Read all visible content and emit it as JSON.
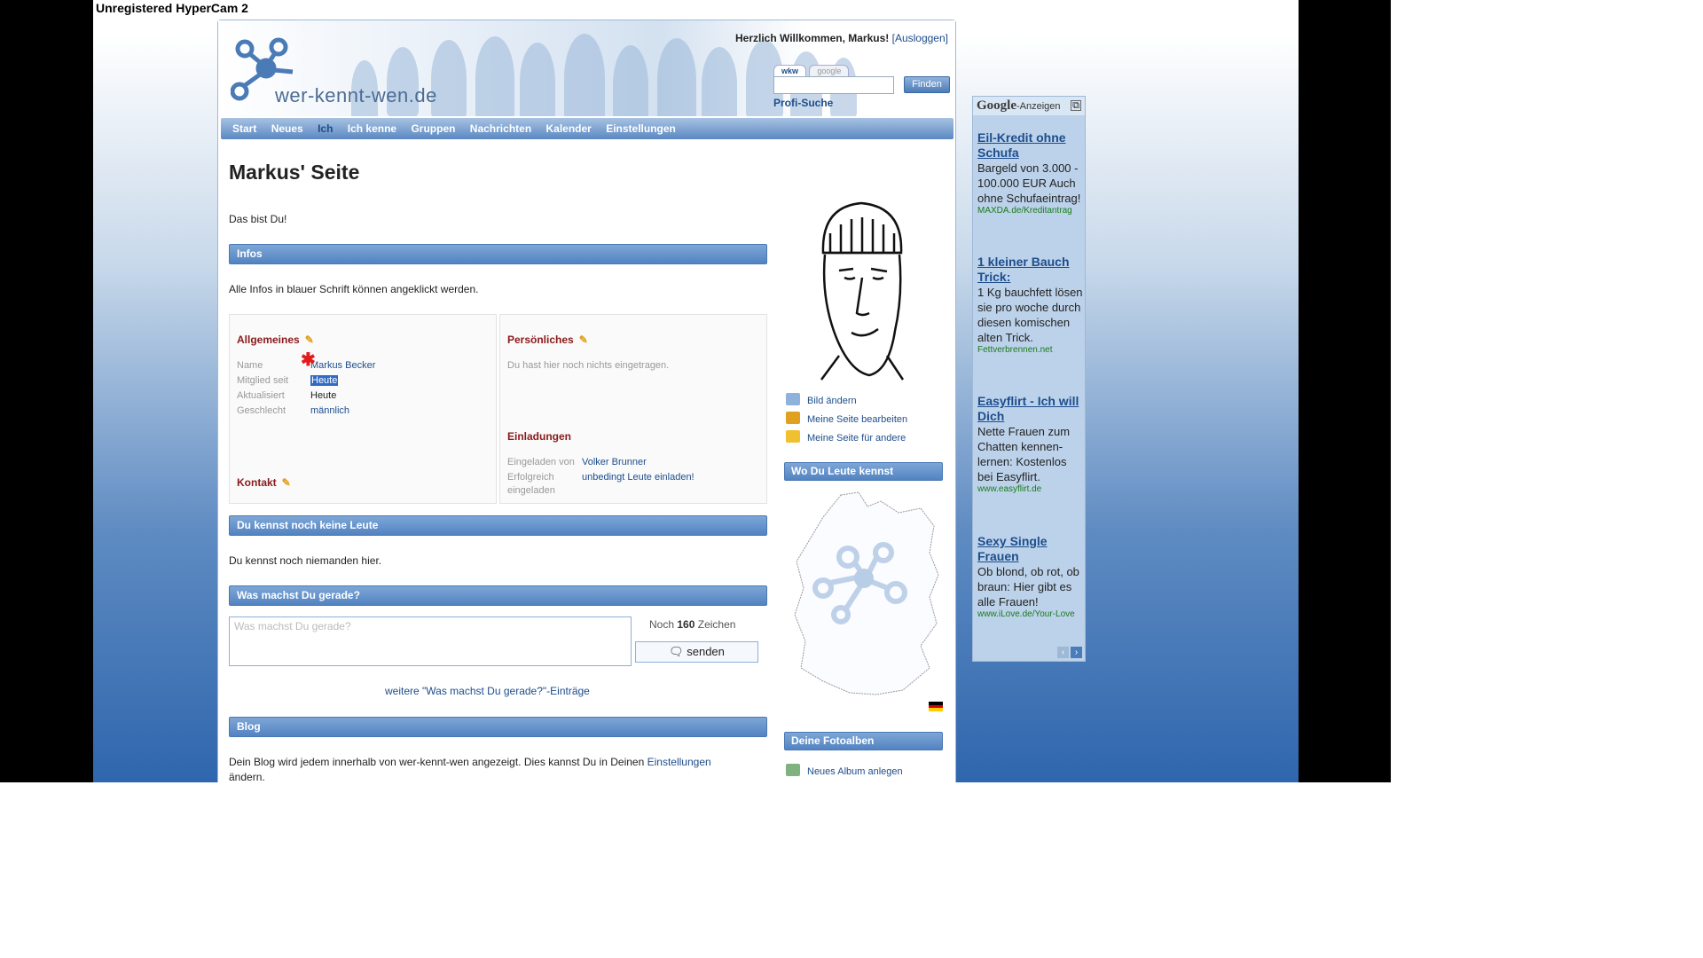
{
  "recorder_banner": "Unregistered HyperCam 2",
  "header": {
    "logo_text": "wer-kennt-wen.de",
    "welcome": "Herzlich Willkommen, Markus!",
    "logout": "[Ausloggen]",
    "search_tabs": [
      "wkw",
      "google"
    ],
    "search_button": "Finden",
    "profi_search": "Profi-Suche"
  },
  "nav": [
    "Start",
    "Neues",
    "Ich",
    "Ich kenne",
    "Gruppen",
    "Nachrichten",
    "Kalender",
    "Einstellungen"
  ],
  "nav_active": "Ich",
  "page_title": "Markus' Seite",
  "this_is_you": "Das bist Du!",
  "infos": {
    "bar": "Infos",
    "hint": "Alle Infos in blauer Schrift können angeklickt werden.",
    "allgemeines": {
      "title": "Allgemeines",
      "rows": [
        {
          "label": "Name",
          "value": "Markus Becker"
        },
        {
          "label": "Mitglied seit",
          "value": "Heute"
        },
        {
          "label": "Aktualisiert",
          "value": "Heute"
        },
        {
          "label": "Geschlecht",
          "value": "männlich"
        }
      ]
    },
    "kontakt": {
      "title": "Kontakt"
    },
    "persoenliches": {
      "title": "Persönliches",
      "empty": "Du hast hier noch nichts eingetragen."
    },
    "einladungen": {
      "title": "Einladungen",
      "invited_by_label": "Eingeladen von",
      "invited_by_value": "Volker Brunner",
      "success_label_1": "Erfolgreich",
      "success_label_2": "eingeladen",
      "success_value": "unbedingt Leute einladen!"
    }
  },
  "known": {
    "bar": "Du kennst noch keine Leute",
    "text": "Du kennst noch niemanden hier."
  },
  "status": {
    "bar": "Was machst Du gerade?",
    "placeholder": "Was machst Du gerade?",
    "counter_prefix": "Noch",
    "counter_value": "160",
    "counter_suffix": "Zeichen",
    "send": "senden",
    "more": "weitere \"Was machst Du gerade?\"-Einträge"
  },
  "blog": {
    "bar": "Blog",
    "text": "Dein Blog wird jedem innerhalb von wer-kennt-wen angezeigt. Dies kannst Du in Deinen",
    "link": "Einstellungen",
    "text2": "ändern."
  },
  "side_actions": [
    "Bild ändern",
    "Meine Seite bearbeiten",
    "Meine Seite für andere"
  ],
  "where_bar": "Wo Du Leute kennst",
  "albums_bar": "Deine Fotoalben",
  "new_album": "Neues Album anlegen",
  "ads": {
    "brand": "Google",
    "label": "-Anzeigen",
    "items": [
      {
        "title": "Eil-Kredit ohne Schufa",
        "desc": "Bargeld von 3.000 - 100.000 EUR Auch ohne Schufaeintrag!",
        "url": "MAXDA.de/Kreditantrag"
      },
      {
        "title": "1 kleiner Bauch Trick:",
        "desc": "1 Kg bauchfett lösen sie pro woche durch diesen komischen alten Trick.",
        "url": "Fettverbrennen.net"
      },
      {
        "title": "Easyflirt - Ich will Dich",
        "desc": "Nette Frauen zum Chatten kennen-lernen: Kostenlos bei Easyflirt.",
        "url": "www.easyflirt.de"
      },
      {
        "title": "Sexy Single Frauen",
        "desc": "Ob blond, ob rot, ob braun: Hier gibt es alle Frauen!",
        "url": "www.iLove.de/Your-Love"
      }
    ]
  },
  "colors": {
    "accent": "#5283c1",
    "link": "#1d4d8c",
    "section_title": "#8b1a1a"
  }
}
